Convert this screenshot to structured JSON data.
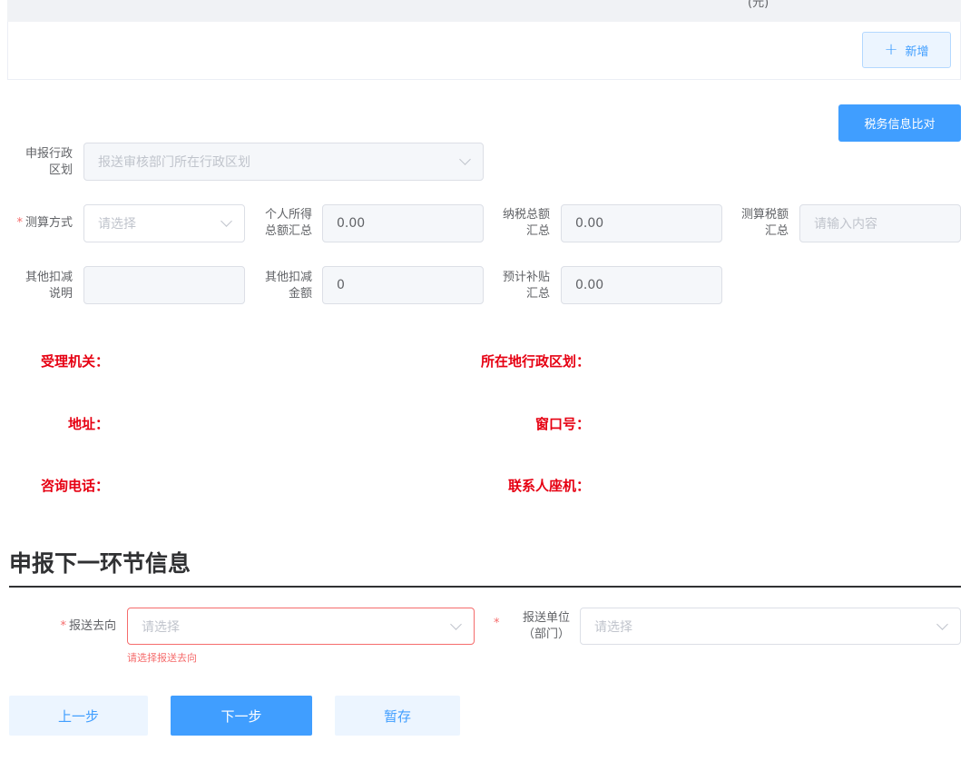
{
  "table": {
    "unit_fragment": "(元)",
    "add_label": "新增",
    "add_icon": "plus-icon"
  },
  "compare_button": "税务信息比对",
  "region": {
    "label": "申报行政区划",
    "placeholder": "报送审核部门所在行政区划"
  },
  "row1": {
    "method_label": "测算方式",
    "method_placeholder": "请选择",
    "income_label": "个人所得总额汇总",
    "income_value": "0.00",
    "tax_label": "纳税总额汇总",
    "tax_value": "0.00",
    "calc_tax_label": "测算税额汇总",
    "calc_tax_placeholder": "请输入内容"
  },
  "row2": {
    "other_desc_label": "其他扣减说明",
    "other_desc_value": "",
    "other_amount_label": "其他扣减金额",
    "other_amount_value": "0",
    "subsidy_label": "预计补贴汇总",
    "subsidy_value": "0.00"
  },
  "info": {
    "agency": "受理机关：",
    "region": "所在地行政区划：",
    "address": "地址：",
    "window": "窗口号：",
    "phone": "咨询电话：",
    "contact": "联系人座机："
  },
  "next_section": {
    "title": "申报下一环节信息",
    "dest_label": "报送去向",
    "dest_placeholder": "请选择",
    "dest_error": "请选择报送去向",
    "unit_label": "报送单位（部门）",
    "unit_placeholder": "请选择"
  },
  "buttons": {
    "prev": "上一步",
    "next": "下一步",
    "save": "暂存"
  },
  "colors": {
    "primary": "#409eff",
    "danger": "#f56c6c",
    "info_red": "#e60012"
  }
}
